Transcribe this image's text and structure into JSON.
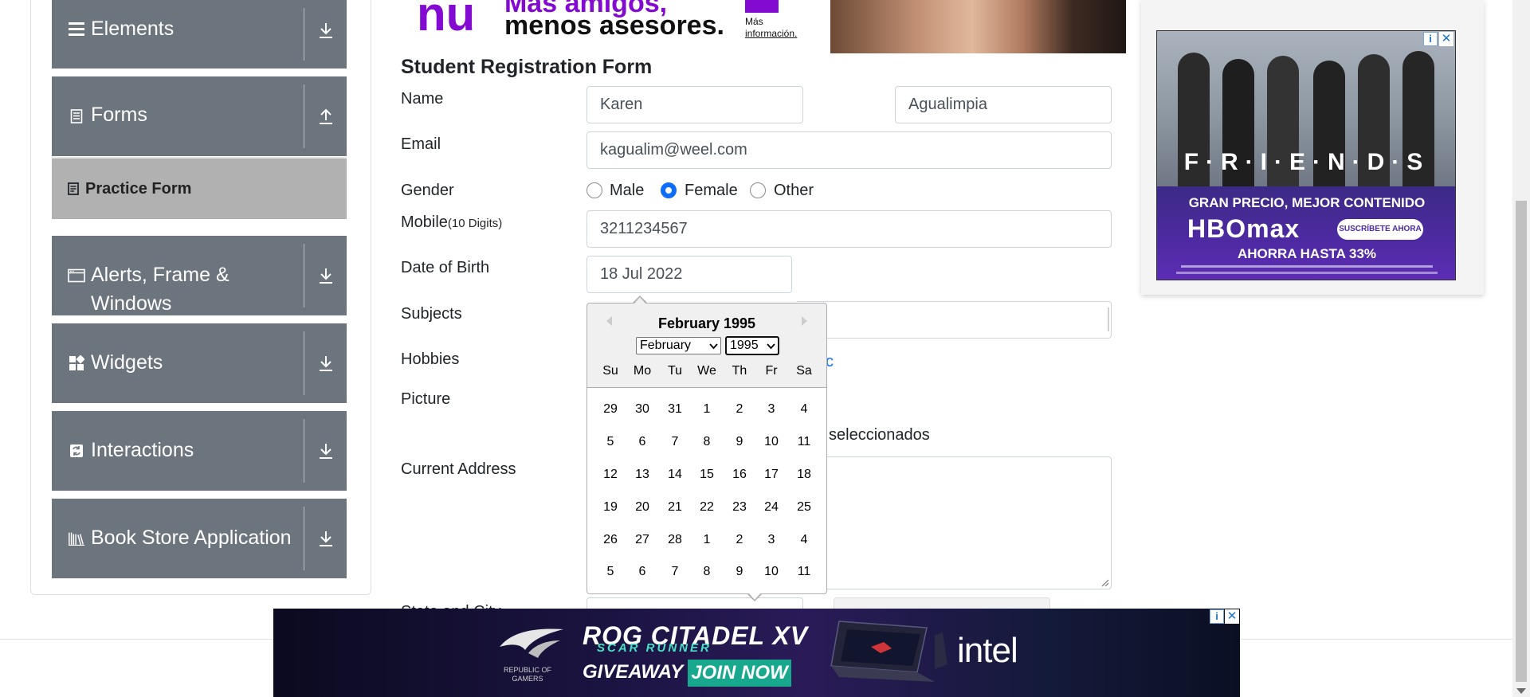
{
  "sidebar": {
    "groups": [
      {
        "label": "Elements",
        "icon": "menu-lines-icon",
        "toggle": "download-arrow-icon"
      },
      {
        "label": "Forms",
        "icon": "document-icon",
        "toggle": "upload-arrow-icon"
      },
      {
        "label": "Alerts, Frame &",
        "label2": "Windows",
        "icon": "window-icon",
        "toggle": "download-arrow-icon"
      },
      {
        "label": "Widgets",
        "icon": "widgets-grid-icon",
        "toggle": "download-arrow-icon"
      },
      {
        "label": "Interactions",
        "icon": "interaction-icon",
        "toggle": "download-arrow-icon"
      },
      {
        "label": "Book Store Application",
        "icon": "books-icon",
        "toggle": "download-arrow-icon"
      }
    ],
    "active_item": {
      "label": "Practice Form",
      "icon": "form-icon"
    }
  },
  "top_ad": {
    "logo": "nu",
    "line1": "Más amigos,",
    "line2": "menos asesores.",
    "more_line1": "Más",
    "more_line2": "información."
  },
  "form": {
    "title": "Student Registration Form",
    "labels": {
      "name": "Name",
      "email": "Email",
      "gender": "Gender",
      "mobile": "Mobile",
      "mobile_hint": "(10 Digits)",
      "dob": "Date of Birth",
      "subjects": "Subjects",
      "hobbies": "Hobbies",
      "picture": "Picture",
      "address": "Current Address",
      "state_city": "State and City"
    },
    "first_name": "Karen",
    "last_name": "Agualimpia",
    "email": "kagualim@weel.com",
    "gender_options": [
      "Male",
      "Female",
      "Other"
    ],
    "gender_selected": "Female",
    "mobile": "3211234567",
    "dob": "18 Jul 2022",
    "hobbies_visible_tail": "c",
    "picture_status_tail": "seleccionados"
  },
  "datepicker": {
    "title": "February 1995",
    "month_select": "February",
    "year_select": "1995",
    "weekdays": [
      "Su",
      "Mo",
      "Tu",
      "We",
      "Th",
      "Fr",
      "Sa"
    ],
    "weeks": [
      [
        "29",
        "30",
        "31",
        "1",
        "2",
        "3",
        "4"
      ],
      [
        "5",
        "6",
        "7",
        "8",
        "9",
        "10",
        "11"
      ],
      [
        "12",
        "13",
        "14",
        "15",
        "16",
        "17",
        "18"
      ],
      [
        "19",
        "20",
        "21",
        "22",
        "23",
        "24",
        "25"
      ],
      [
        "26",
        "27",
        "28",
        "1",
        "2",
        "3",
        "4"
      ],
      [
        "5",
        "6",
        "7",
        "8",
        "9",
        "10",
        "11"
      ]
    ]
  },
  "right_ad": {
    "show_word": "F·R·I·E·N·D·S",
    "line1": "GRAN PRECIO, MEJOR CONTENIDO",
    "brand": "HBOmax",
    "cta": "SUSCRÍBETE AHORA",
    "line2": "AHORRA HASTA 33%"
  },
  "bottom_ad": {
    "brand_caption": "REPUBLIC OF GAMERS",
    "product": "ROG CITADEL XV",
    "subproduct": "SCAR RUNNER",
    "giveaway": "GIVEAWAY",
    "cta": "JOIN NOW",
    "partner": "intel"
  },
  "colors": {
    "sidebar_group": "#6c757d",
    "active_item": "#b1b1b1",
    "radio_checked": "#0d6efd",
    "datepicker_header": "#f0f0f0",
    "ad_purple": "#820ad1"
  }
}
